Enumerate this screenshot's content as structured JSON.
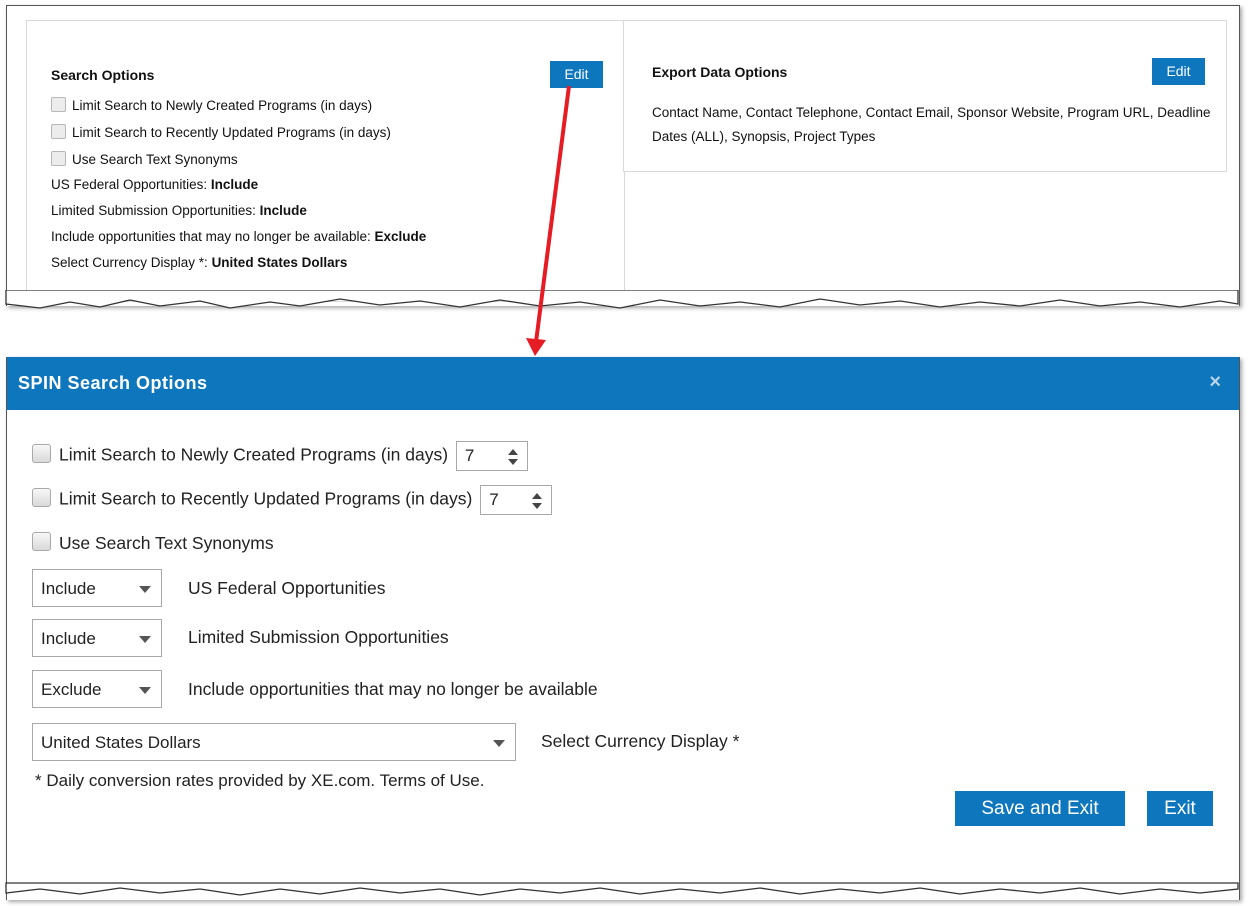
{
  "search_options": {
    "title": "Search Options",
    "edit_label": "Edit",
    "checkbox_newly_created": "Limit Search to Newly Created Programs (in days)",
    "checkbox_recently_updated": "Limit Search to Recently Updated Programs (in days)",
    "checkbox_synonyms": "Use Search Text Synonyms",
    "us_federal_label": "US Federal Opportunities: ",
    "us_federal_value": "Include",
    "limited_submission_label": "Limited Submission Opportunities: ",
    "limited_submission_value": "Include",
    "no_longer_available_label": "Include opportunities that may no longer be available: ",
    "no_longer_available_value": "Exclude",
    "currency_label": "Select Currency Display *: ",
    "currency_value": "United States Dollars"
  },
  "export_options": {
    "title": "Export Data Options",
    "edit_label": "Edit",
    "fields_text": "Contact Name, Contact Telephone, Contact Email, Sponsor Website, Program URL, Deadline Dates (ALL), Synopsis, Project Types"
  },
  "dialog": {
    "title": "SPIN Search Options",
    "close_icon": "×",
    "newly_created_label": "Limit Search to Newly Created Programs (in days)",
    "newly_created_days": "7",
    "recently_updated_label": "Limit Search to Recently Updated Programs (in days)",
    "recently_updated_days": "7",
    "synonyms_label": "Use Search Text Synonyms",
    "us_federal_select": "Include",
    "us_federal_label": "US Federal Opportunities",
    "limited_submission_select": "Include",
    "limited_submission_label": "Limited Submission Opportunities",
    "no_longer_available_select": "Exclude",
    "no_longer_available_label": "Include opportunities that may no longer be available",
    "currency_select": "United States Dollars",
    "currency_label": "Select Currency Display *",
    "conversion_note": "* Daily conversion rates provided by XE.com. Terms of Use.",
    "save_exit_label": "Save and Exit",
    "exit_label": "Exit"
  },
  "colors": {
    "accent_blue": "#0e76bc",
    "arrow_red": "#e51c23"
  }
}
